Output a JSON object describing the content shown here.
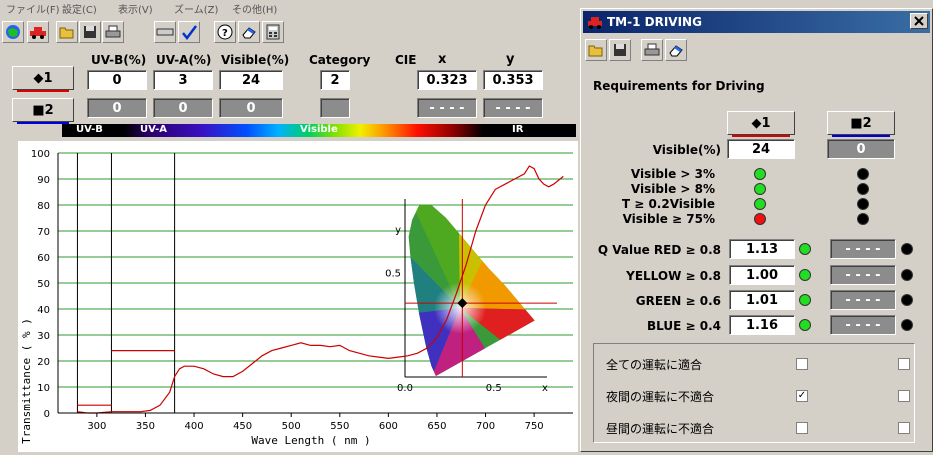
{
  "menu": [
    "ファイル(F)",
    "設定(C)",
    "表示(V)",
    "ズーム(Z)",
    "その他(H)"
  ],
  "headers": {
    "uvb": "UV-B(%)",
    "uva": "UV-A(%)",
    "visible": "Visible(%)",
    "category": "Category",
    "cie": "CIE",
    "x": "x",
    "y": "y"
  },
  "sample1": {
    "label": "◆1",
    "uvb": "0",
    "uva": "3",
    "visible": "24",
    "category": "2",
    "x": "0.323",
    "y": "0.353",
    "underline_color": "#dd0000"
  },
  "sample2": {
    "label": "■2",
    "uvb": "0",
    "uva": "0",
    "visible": "0",
    "category": "",
    "x": "- - - -",
    "y": "- - - -",
    "underline_color": "#0000dd"
  },
  "spectrum_labels": {
    "uvb": "UV-B",
    "uva": "UV-A",
    "visible": "Visible",
    "ir": "IR"
  },
  "chart_data": {
    "type": "line",
    "xlabel": "Wave Length ( nm )",
    "ylabel": "Transmittance ( % )",
    "xlim": [
      260,
      790
    ],
    "ylim": [
      0,
      100
    ],
    "x_ticks": [
      300,
      350,
      400,
      450,
      500,
      550,
      600,
      650,
      700,
      750
    ],
    "y_ticks": [
      0,
      10,
      20,
      30,
      40,
      50,
      60,
      70,
      80,
      90,
      100
    ],
    "grid": true,
    "vertical_lines": [
      280,
      315,
      380
    ],
    "region_levels": [
      {
        "x1": 280,
        "x2": 315,
        "value": 3
      },
      {
        "x1": 315,
        "x2": 380,
        "value": 24
      }
    ],
    "series": [
      {
        "color": "#cc0000",
        "x": [
          280,
          290,
          300,
          315,
          330,
          345,
          355,
          365,
          375,
          380,
          385,
          390,
          400,
          410,
          420,
          430,
          440,
          450,
          460,
          470,
          480,
          490,
          500,
          510,
          520,
          530,
          540,
          550,
          560,
          570,
          580,
          590,
          600,
          610,
          620,
          630,
          640,
          650,
          660,
          670,
          680,
          690,
          700,
          710,
          720,
          730,
          740,
          745,
          750,
          755,
          760,
          765,
          770,
          780
        ],
        "y": [
          0.5,
          0,
          0,
          0.5,
          0.5,
          0.5,
          1,
          3,
          8,
          14,
          17,
          18,
          18,
          17,
          15,
          14,
          14,
          16,
          19,
          22,
          24,
          25,
          26,
          27,
          26,
          26,
          25.5,
          26,
          24,
          23,
          22,
          21.5,
          21,
          21.5,
          22,
          23,
          25,
          29,
          36,
          46,
          57,
          70,
          80,
          86,
          88,
          90,
          92,
          95,
          94,
          90,
          88,
          87,
          88,
          91
        ]
      }
    ],
    "cie_inset": {
      "x_ticks": [
        "0.0",
        "0.5"
      ],
      "y_ticks": [
        "0.5"
      ],
      "x_label": "x",
      "y_label": "y",
      "point": {
        "x": 0.323,
        "y": 0.353
      }
    }
  },
  "dialog": {
    "title": "TM-1  DRIVING",
    "requirements_title": "Requirements for Driving",
    "sample1_label": "◆1",
    "sample2_label": "■2",
    "visible_label": "Visible(%)",
    "visible1": "24",
    "visible2": "0",
    "checks": [
      {
        "label": "Visible > 3%",
        "s1": "green",
        "s2": "black"
      },
      {
        "label": "Visible > 8%",
        "s1": "green",
        "s2": "black"
      },
      {
        "label": "T ≥ 0.2Visible",
        "s1": "green",
        "s2": "black"
      },
      {
        "label": "Visible ≥ 75%",
        "s1": "red",
        "s2": "black"
      }
    ],
    "q_values": [
      {
        "label": "Q Value RED ≥ 0.8",
        "v1": "1.13",
        "v2": "- - - -",
        "s1": "green",
        "s2": "black"
      },
      {
        "label": "YELLOW ≥ 0.8",
        "v1": "1.00",
        "v2": "- - - -",
        "s1": "green",
        "s2": "black"
      },
      {
        "label": "GREEN ≥ 0.6",
        "v1": "1.01",
        "v2": "- - - -",
        "s1": "green",
        "s2": "black"
      },
      {
        "label": "BLUE ≥ 0.4",
        "v1": "1.16",
        "v2": "- - - -",
        "s1": "green",
        "s2": "black"
      }
    ],
    "fitness": [
      {
        "label": "全ての運転に適合",
        "c1": "",
        "c2": ""
      },
      {
        "label": "夜間の運転に不適合",
        "c1": "✓",
        "c2": ""
      },
      {
        "label": "昼間の運転に不適合",
        "c1": "",
        "c2": ""
      }
    ]
  }
}
